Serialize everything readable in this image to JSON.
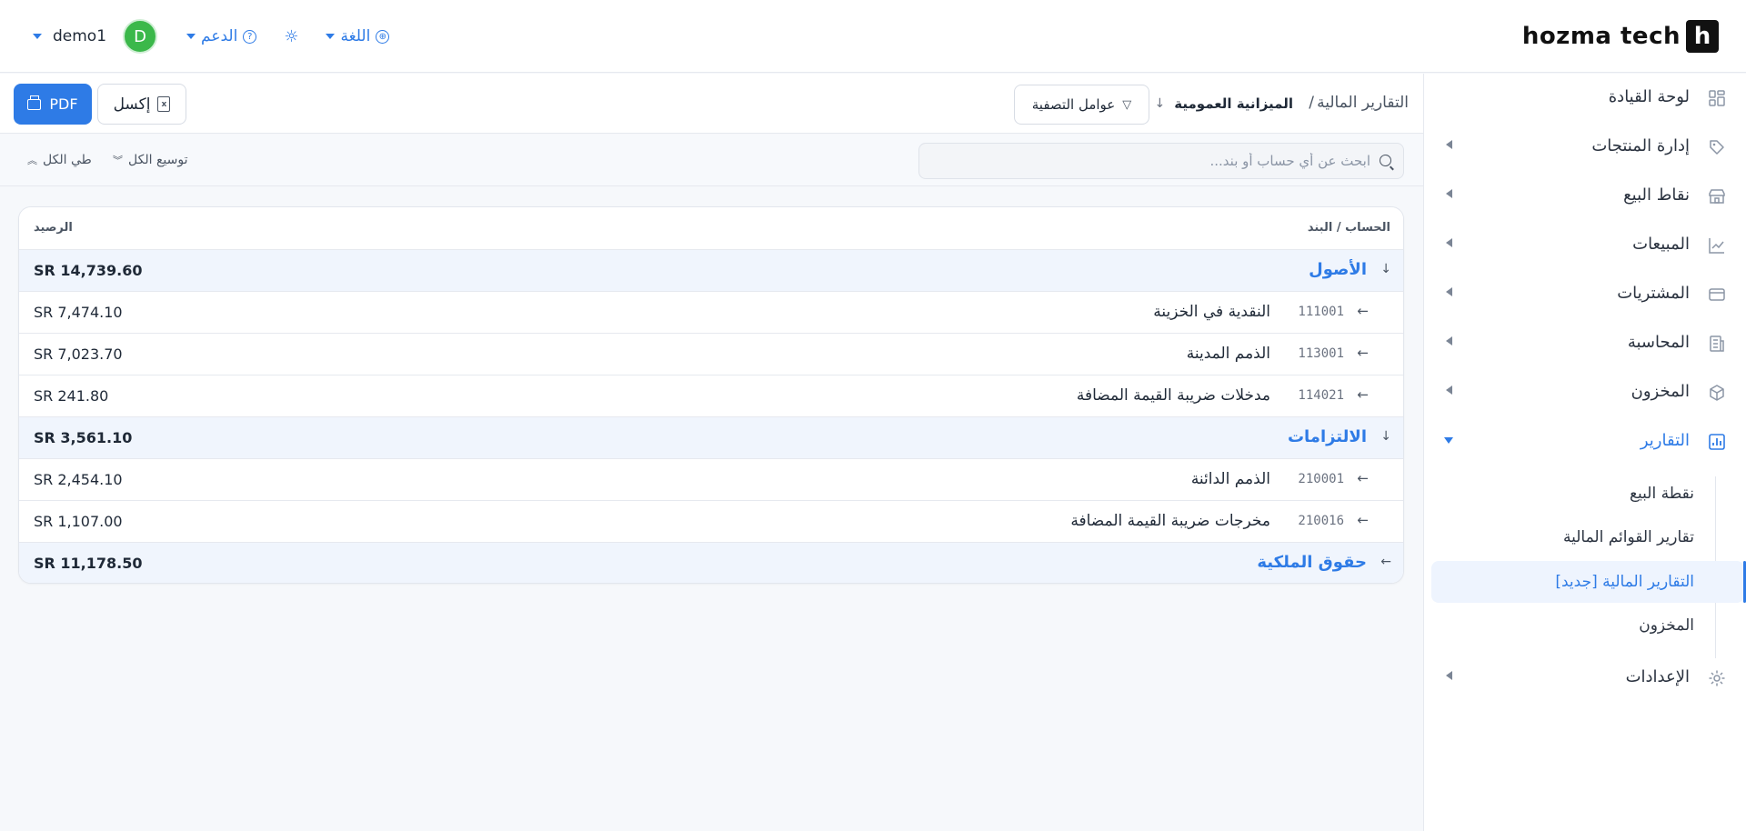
{
  "header": {
    "brand_mark": "h",
    "brand_name": "hozma tech",
    "user_name": "demo1",
    "avatar_initial": "D",
    "support_label": "الدعم",
    "support_icon": "?",
    "theme_icon": "☼",
    "language_label": "اللغة",
    "language_icon": "⊕"
  },
  "sidebar": {
    "items": [
      {
        "label": "لوحة القيادة",
        "icon": "dashboard-icon"
      },
      {
        "label": "إدارة المنتجات",
        "icon": "tag-icon"
      },
      {
        "label": "نقاط البيع",
        "icon": "store-icon"
      },
      {
        "label": "المبيعات",
        "icon": "chart-line-icon"
      },
      {
        "label": "المشتريات",
        "icon": "wallet-icon"
      },
      {
        "label": "المحاسبة",
        "icon": "receipt-icon"
      },
      {
        "label": "المخزون",
        "icon": "box-icon"
      },
      {
        "label": "التقارير",
        "icon": "report-icon"
      },
      {
        "label": "الإعدادات",
        "icon": "gear-icon"
      }
    ],
    "reports_sub": [
      {
        "label": "نقطة البيع"
      },
      {
        "label": "تقارير القوائم المالية"
      },
      {
        "label": "التقارير المالية [جديد]"
      },
      {
        "label": "المخزون"
      }
    ]
  },
  "toolbar": {
    "breadcrumb_root": "التقارير المالية",
    "breadcrumb_sep": "/",
    "report_select": "الميزانية العمومية",
    "filters_label": "عوامل التصفية",
    "excel_label": "إكسل",
    "pdf_label": "PDF"
  },
  "search": {
    "placeholder": "ابحث عن أي حساب أو بند...",
    "expand_all": "توسيع الكل",
    "collapse_all": "طي الكل"
  },
  "table": {
    "col_account": "الحساب / البند",
    "col_balance": "الرصيد",
    "groups": [
      {
        "name": "الأصول",
        "total": "SR 14,739.60",
        "expanded": true,
        "accounts": [
          {
            "code": "111001",
            "name": "النقدية في الخزينة",
            "amount": "SR 7,474.10"
          },
          {
            "code": "113001",
            "name": "الذمم المدينة",
            "amount": "SR 7,023.70"
          },
          {
            "code": "114021",
            "name": "مدخلات ضريبة القيمة المضافة",
            "amount": "SR 241.80"
          }
        ]
      },
      {
        "name": "الالتزامات",
        "total": "SR 3,561.10",
        "expanded": true,
        "accounts": [
          {
            "code": "210001",
            "name": "الذمم الدائنة",
            "amount": "SR 2,454.10"
          },
          {
            "code": "210016",
            "name": "مخرجات ضريبة القيمة المضافة",
            "amount": "SR 1,107.00"
          }
        ]
      },
      {
        "name": "حقوق الملكية",
        "total": "SR 11,178.50",
        "expanded": false,
        "accounts": []
      }
    ]
  },
  "colors": {
    "accent": "#2e7be6",
    "avatar": "#3bb84a",
    "group_row_bg": "#f0f5fd"
  }
}
